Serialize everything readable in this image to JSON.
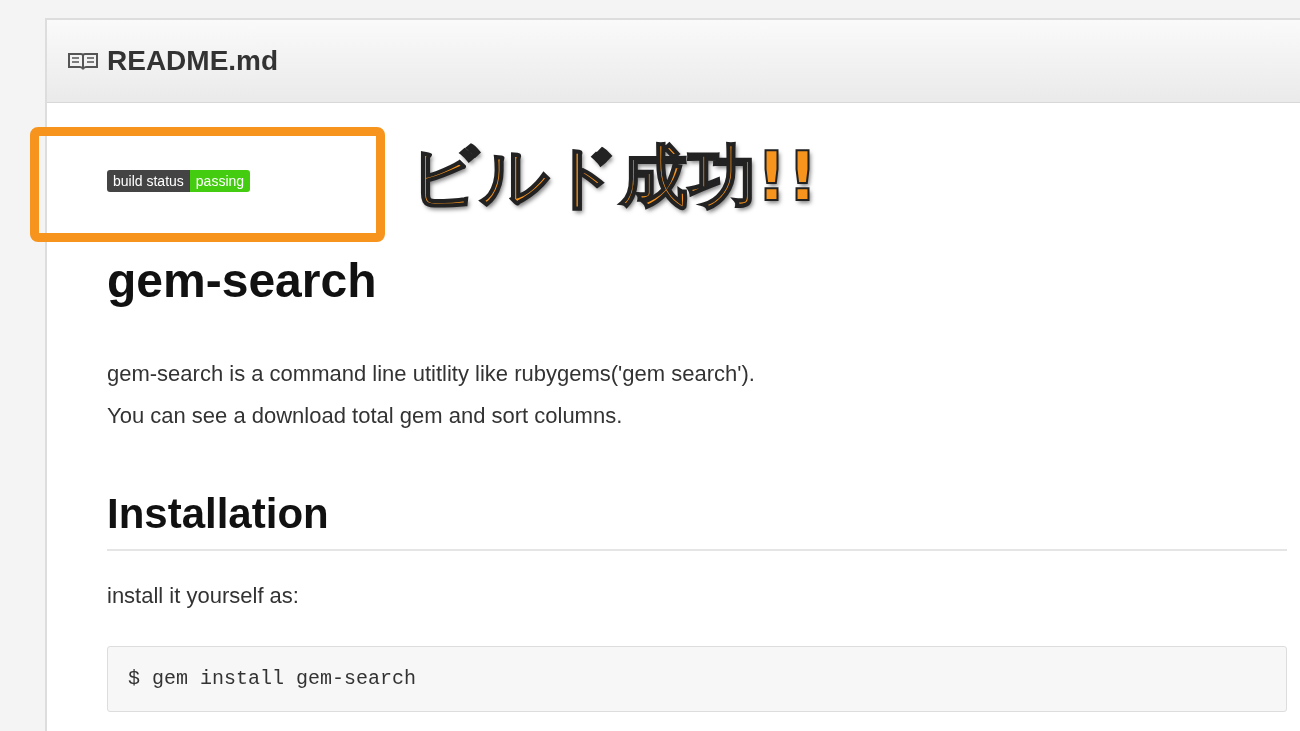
{
  "readme": {
    "title": "README.md"
  },
  "badge": {
    "label": "build status",
    "status": "passing"
  },
  "annotation": {
    "text": "ビルド成功!!"
  },
  "content": [
    {
      "kind": "h1",
      "text": "gem-search"
    },
    {
      "kind": "p",
      "text": "gem-search is a command line utitlity like rubygems('gem search')."
    },
    {
      "kind": "p",
      "text": "You can see a download total gem and sort columns."
    },
    {
      "kind": "h2",
      "text": "Installation"
    },
    {
      "kind": "p",
      "text": "install it yourself as:"
    },
    {
      "kind": "code",
      "text": "$ gem install gem-search"
    }
  ]
}
